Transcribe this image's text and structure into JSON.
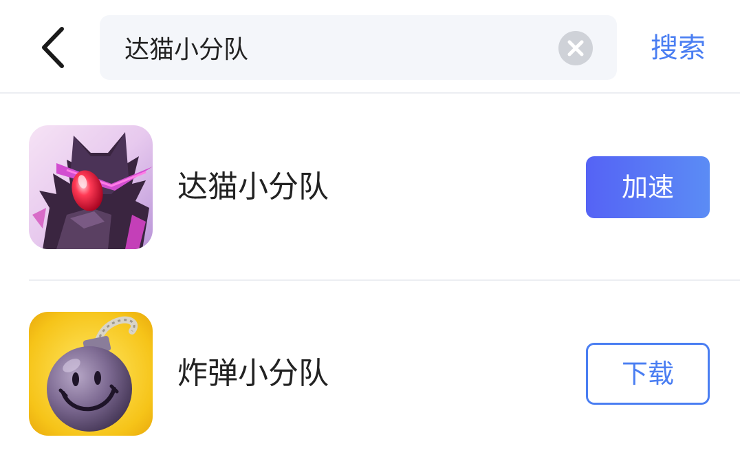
{
  "header": {
    "back_icon": "chevron-left-icon",
    "search": {
      "value": "达猫小分队",
      "placeholder": "",
      "clear_icon": "clear-circle-icon"
    },
    "search_button_label": "搜索"
  },
  "results": [
    {
      "name": "达猫小分队",
      "icon": "dark-cat-knight-game-icon",
      "action_label": "加速",
      "action_style": "primary"
    },
    {
      "name": "炸弹小分队",
      "icon": "smiling-bomb-game-icon",
      "action_label": "下载",
      "action_style": "outline"
    }
  ],
  "colors": {
    "accent": "#4a7ef2",
    "accent_gradient_start": "#5563f5",
    "accent_gradient_end": "#5b8cf5",
    "search_bg": "#f4f6fa",
    "text": "#222222",
    "divider": "#eceef2"
  }
}
